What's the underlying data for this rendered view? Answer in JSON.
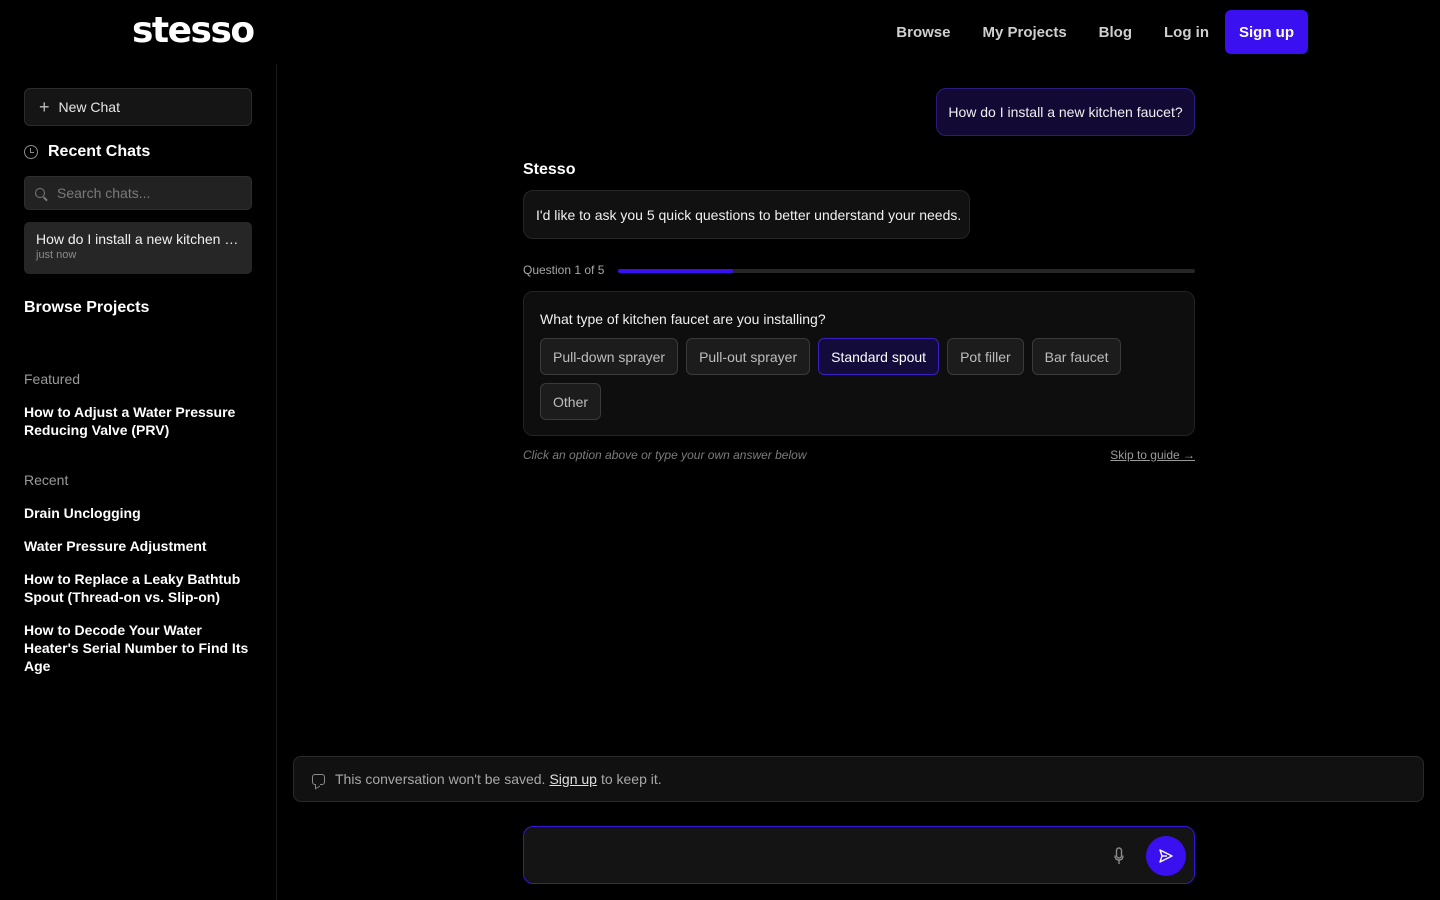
{
  "header": {
    "logo": "stesso",
    "nav": [
      "Browse",
      "My Projects",
      "Blog"
    ],
    "login": "Log in",
    "signup": "Sign up"
  },
  "sidebar": {
    "new_chat": "New Chat",
    "recent_chats_title": "Recent Chats",
    "search_placeholder": "Search chats...",
    "chat_item": {
      "title": "How do I install a new kitchen faucet?",
      "time": "just now"
    },
    "browse_title": "Browse Projects",
    "featured_label": "Featured",
    "featured": [
      "How to Adjust a Water Pressure Reducing Valve (PRV)"
    ],
    "recent_label": "Recent",
    "recent": [
      "Drain Unclogging",
      "Water Pressure Adjustment",
      "How to Replace a Leaky Bathtub Spout (Thread-on vs. Slip-on)",
      "How to Decode Your Water Heater's Serial Number to Find Its Age"
    ]
  },
  "conversation": {
    "user_message": "How do I install a new kitchen faucet?",
    "bot_name": "Stesso",
    "bot_message": "I'd like to ask you 5 quick questions to better understand your needs.",
    "question_label": "Question 1 of 5",
    "progress_fraction": 0.2,
    "question": "What type of kitchen faucet are you installing?",
    "options": [
      "Pull-down sprayer",
      "Pull-out sprayer",
      "Standard spout",
      "Pot filler",
      "Bar faucet",
      "Other"
    ],
    "selected_option": "Standard spout",
    "hint": "Click an option above or type your own answer below",
    "skip": "Skip to guide →"
  },
  "notice": {
    "before": "This conversation won't be saved.",
    "link": "Sign up",
    "after": "to keep it."
  },
  "composer": {
    "value": ""
  },
  "icons": {
    "new_chat": "plus-icon",
    "recent": "clock-icon",
    "search": "search-icon",
    "notice": "chat-bubble-icon",
    "voice": "microphone-icon",
    "send": "send-icon"
  },
  "colors": {
    "accent": "#3a0ff0",
    "background": "#000000"
  }
}
